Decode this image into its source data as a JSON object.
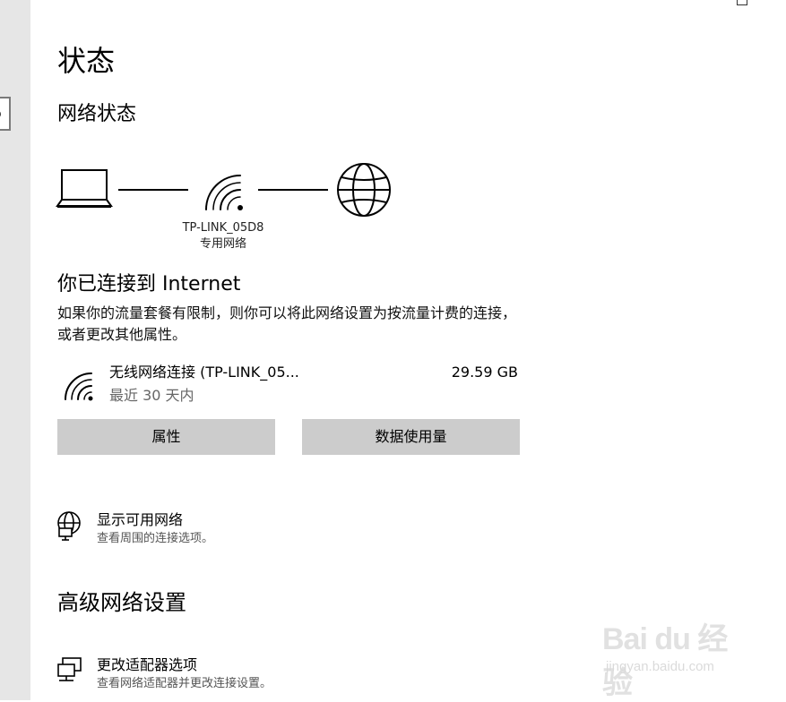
{
  "page": {
    "title": "状态",
    "network_status_heading": "网络状态",
    "advanced_heading": "高级网络设置"
  },
  "diagram": {
    "network_name": "TP-LINK_05D8",
    "network_type": "专用网络",
    "icons": [
      "laptop-icon",
      "wifi-icon",
      "globe-icon"
    ]
  },
  "connection": {
    "title": "你已连接到 Internet",
    "description": "如果你的流量套餐有限制，则你可以将此网络设置为按流量计费的连接，或者更改其他属性。"
  },
  "adapter": {
    "name": "无线网络连接 (TP-LINK_05...",
    "usage": "29.59 GB",
    "period": "最近 30 天内"
  },
  "buttons": {
    "properties": "属性",
    "data_usage": "数据使用量"
  },
  "links": [
    {
      "title": "显示可用网络",
      "subtitle": "查看周围的连接选项。",
      "icon": "globe-network-icon"
    },
    {
      "title": "更改适配器选项",
      "subtitle": "查看网络适配器并更改连接设置。",
      "icon": "adapter-icon"
    }
  ],
  "watermark": {
    "logo": "Bai du 经验",
    "site": "jingyan.baidu.com"
  },
  "colors": {
    "sidebar_bg": "#e6e6e6",
    "button_bg": "#cccccc",
    "secondary_text": "#666666"
  }
}
